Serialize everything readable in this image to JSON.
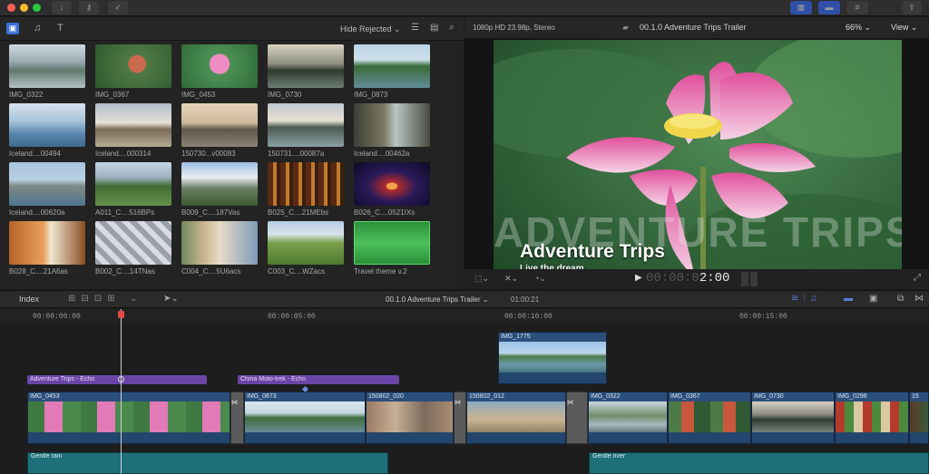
{
  "browser": {
    "hide_rejected": "Hide Rejected",
    "clips": [
      {
        "name": "IMG_0322",
        "scene": "river-boats"
      },
      {
        "name": "IMG_0367",
        "scene": "man-smiling"
      },
      {
        "name": "IMG_0453",
        "scene": "lotus"
      },
      {
        "name": "IMG_0730",
        "scene": "sunset-lake"
      },
      {
        "name": "IMG_0873",
        "scene": "karst-river"
      },
      {
        "name": "Iceland....00494",
        "scene": "glacier-lagoon"
      },
      {
        "name": "Iceland....000314",
        "scene": "coast-rocks"
      },
      {
        "name": "150730...v00083",
        "scene": "sea-rocks"
      },
      {
        "name": "150731....00087a",
        "scene": "island-sea"
      },
      {
        "name": "Iceland....00462a",
        "scene": "canyon"
      },
      {
        "name": "Iceland....00620a",
        "scene": "mountain-sea"
      },
      {
        "name": "A011_C....516BPs",
        "scene": "green-mountains"
      },
      {
        "name": "B009_C....187Vas",
        "scene": "alps"
      },
      {
        "name": "B025_C....21MEbs",
        "scene": "bottles"
      },
      {
        "name": "B026_C....0521IXs",
        "scene": "tunnel"
      },
      {
        "name": "B028_C....21A6as",
        "scene": "hall"
      },
      {
        "name": "B002_C....14TNas",
        "scene": "plaza"
      },
      {
        "name": "C004_C....5U6acs",
        "scene": "church"
      },
      {
        "name": "C003_C....WZacs",
        "scene": "cypress"
      },
      {
        "name": "Travel theme v.2",
        "scene": "audio"
      }
    ]
  },
  "viewer": {
    "format": "1080p HD 23.98p, Stereo",
    "project": "00.1.0 Adventure Trips Trailer",
    "zoom": "66%",
    "view": "View",
    "overlay_bg": "ADVENTURE TRIPS",
    "title": "Adventure Trips",
    "subtitle": "Live the dream",
    "timecode_dim": "00:00:0",
    "timecode": "2:00"
  },
  "timeline": {
    "index": "Index",
    "project": "00.1.0 Adventure Trips Trailer",
    "duration": "01:00:21",
    "ruler": [
      "00:00:00:00",
      "00:00:05:00",
      "00:00:10:00",
      "00:00:15:00"
    ],
    "connected_clip": "IMG_1775",
    "titles": [
      "Adventure Trips - Echo",
      "China Moto-trek - Echo"
    ],
    "clips": [
      "IMG_0453",
      "IMG_0873",
      "150802_020",
      "150802_012",
      "IMG_0322",
      "IMG_0367",
      "IMG_0730",
      "IMG_0298",
      "15"
    ],
    "audio": [
      "Gentle rain",
      "Gentle river"
    ]
  },
  "colors": {
    "accent": "#3b6fd9",
    "title_purple": "#6a45a6",
    "clip_blue": "#2b4f7c",
    "audio_teal": "#1f6f78"
  }
}
